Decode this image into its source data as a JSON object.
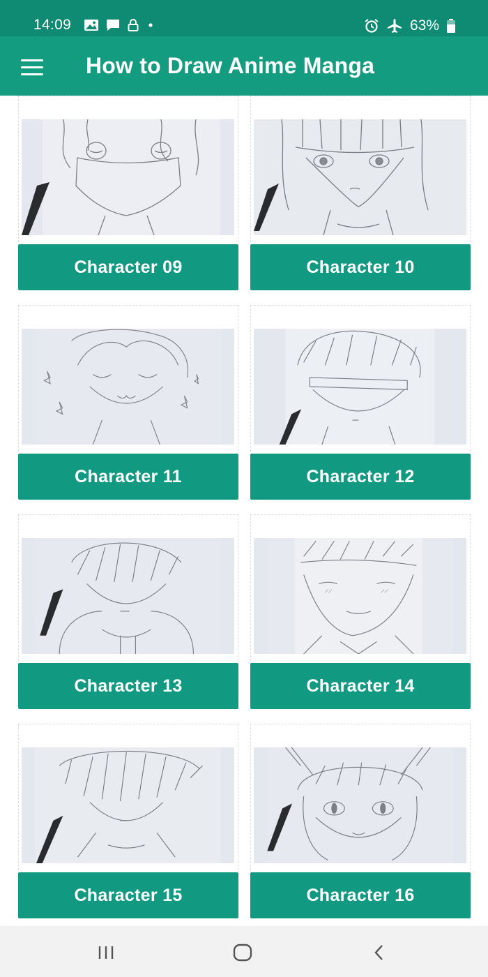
{
  "status_bar": {
    "time": "14:09",
    "battery": "63%",
    "left_icons": [
      "image-icon",
      "message-icon",
      "lock-icon",
      "dot-icon"
    ],
    "right_icons": [
      "alarm-icon",
      "airplane-icon",
      "battery-icon"
    ]
  },
  "app_bar": {
    "title": "How to Draw Anime Manga",
    "menu_icon": "hamburger-menu-icon"
  },
  "cards": [
    {
      "label": "Character 09",
      "thumbnail": "sketch-masked-boy"
    },
    {
      "label": "Character 10",
      "thumbnail": "sketch-girl-bangs"
    },
    {
      "label": "Character 11",
      "thumbnail": "sketch-smiling-boy"
    },
    {
      "label": "Character 12",
      "thumbnail": "sketch-blindfold-boy"
    },
    {
      "label": "Character 13",
      "thumbnail": "sketch-hooded-boy"
    },
    {
      "label": "Character 14",
      "thumbnail": "sketch-blushing-boy"
    },
    {
      "label": "Character 15",
      "thumbnail": "sketch-messy-hair-boy"
    },
    {
      "label": "Character 16",
      "thumbnail": "sketch-cat-ear-girl"
    }
  ],
  "nav_bar": {
    "icons": [
      "recent-apps-icon",
      "home-icon",
      "back-icon"
    ]
  },
  "colors": {
    "status_bar": "#0f8a73",
    "app_bar": "#139c7f",
    "button": "#119a81",
    "nav_bar": "#f2f2f2"
  }
}
